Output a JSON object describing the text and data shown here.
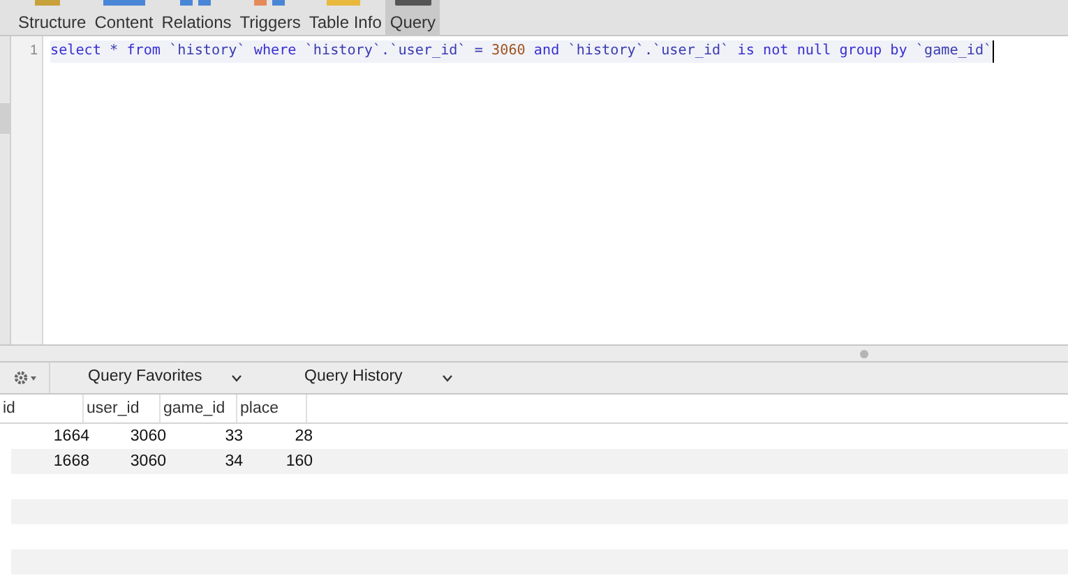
{
  "toolbar": {
    "tabs": [
      {
        "label": "Structure",
        "selected": false
      },
      {
        "label": "Content",
        "selected": false
      },
      {
        "label": "Relations",
        "selected": false
      },
      {
        "label": "Triggers",
        "selected": false
      },
      {
        "label": "Table Info",
        "selected": false
      },
      {
        "label": "Query",
        "selected": true
      }
    ]
  },
  "editor": {
    "lines": [
      {
        "number": "1",
        "tokens": [
          {
            "kind": "keyword",
            "text": "select"
          },
          {
            "kind": "plain",
            "text": " * "
          },
          {
            "kind": "keyword",
            "text": "from"
          },
          {
            "kind": "plain",
            "text": " `history` "
          },
          {
            "kind": "keyword",
            "text": "where"
          },
          {
            "kind": "plain",
            "text": " `history`.`user_id` = "
          },
          {
            "kind": "number",
            "text": "3060"
          },
          {
            "kind": "keyword",
            "text": " and"
          },
          {
            "kind": "plain",
            "text": " `history`.`user_id` "
          },
          {
            "kind": "keyword",
            "text": "is not null group by"
          },
          {
            "kind": "plain",
            "text": " `game_id`"
          }
        ]
      }
    ]
  },
  "query_bar": {
    "favorites": "Query Favorites",
    "history": "Query History"
  },
  "results": {
    "columns": [
      "id",
      "user_id",
      "game_id",
      "place"
    ],
    "rows": [
      [
        "1664",
        "3060",
        "33",
        "28"
      ],
      [
        "1668",
        "3060",
        "34",
        "160"
      ]
    ]
  }
}
